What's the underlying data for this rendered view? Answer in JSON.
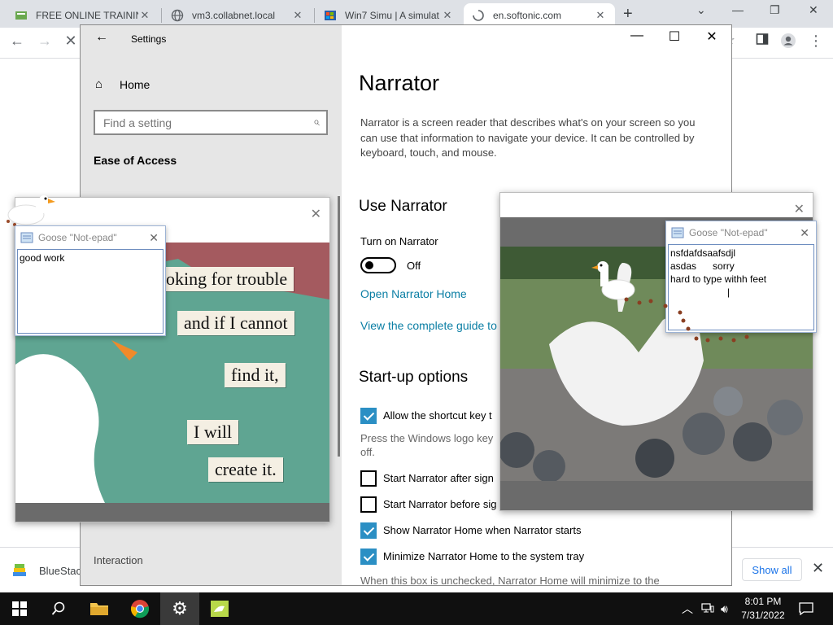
{
  "browser": {
    "tabs": [
      {
        "title": "FREE ONLINE TRAINING",
        "active": false
      },
      {
        "title": "vm3.collabnet.local",
        "active": false
      },
      {
        "title": "Win7 Simu | A simulat",
        "active": false
      },
      {
        "title": "en.softonic.com",
        "active": true
      }
    ],
    "new_tab": "+",
    "download": {
      "file": "BlueStac",
      "show_all": "Show all"
    }
  },
  "settings": {
    "app_title": "Settings",
    "home": "Home",
    "search_placeholder": "Find a setting",
    "section": "Ease of Access",
    "interaction": "Interaction",
    "page_title": "Narrator",
    "description": "Narrator is a screen reader that describes what's on your screen so you can use that information to navigate your device. It can be controlled by keyboard, touch, and mouse.",
    "use_narrator": {
      "heading": "Use Narrator",
      "toggle_label": "Turn on Narrator",
      "toggle_state": "Off",
      "link_home": "Open Narrator Home",
      "link_guide": "View the complete guide to"
    },
    "startup": {
      "heading": "Start-up options",
      "options": [
        {
          "label": "Allow the shortcut key t",
          "checked": true
        },
        {
          "label": "Start Narrator after sign",
          "checked": false
        },
        {
          "label": "Start Narrator before sig",
          "checked": false
        },
        {
          "label": "Show Narrator Home when Narrator starts",
          "checked": true
        },
        {
          "label": "Minimize Narrator Home to the system tray",
          "checked": true
        }
      ],
      "shortcut_desc_1": "Press the Windows logo key",
      "shortcut_desc_2": "off.",
      "minimize_desc": "When this box is unchecked, Narrator Home will minimize to the"
    }
  },
  "goose_left": {
    "notepad_title": "Goose \"Not-epad\"",
    "notepad_text": "good work",
    "notes": [
      "oking for trouble",
      "and if I cannot",
      "find it,",
      "I will",
      "create it."
    ]
  },
  "goose_right": {
    "notepad_title": "Goose \"Not-epad\"",
    "notepad_text": "nsfdafdsaafsdjl\nasdas      sorry\nhard to type withh feet\n                     |"
  },
  "taskbar": {
    "time": "8:01 PM",
    "date": "7/31/2022"
  },
  "colors": {
    "accent": "#2b8fc4",
    "link": "#0a7ea4",
    "taskbar": "#101010",
    "sidebar": "#e6e6e6"
  }
}
